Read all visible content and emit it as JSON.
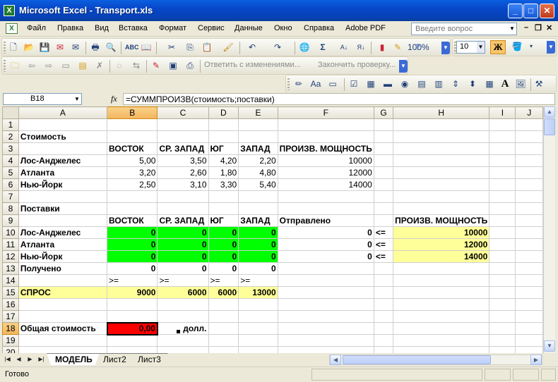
{
  "window": {
    "title": "Microsoft Excel - Transport.xls",
    "app_icon": "X"
  },
  "menu": {
    "items": [
      "Файл",
      "Правка",
      "Вид",
      "Вставка",
      "Формат",
      "Сервис",
      "Данные",
      "Окно",
      "Справка",
      "Adobe PDF"
    ],
    "ask_placeholder": "Введите вопрос"
  },
  "toolbar": {
    "font_size": "10",
    "bold_label": "Ж",
    "sum_symbol": "Σ",
    "reply_changes": "Ответить с изменениями...",
    "end_review": "Закончить проверку..."
  },
  "formula_bar": {
    "name_box": "B18",
    "fx": "fx",
    "formula": "=СУММПРОИЗВ(стоимость;поставки)"
  },
  "sheet": {
    "columns": [
      "A",
      "B",
      "C",
      "D",
      "E",
      "F",
      "G",
      "H",
      "I",
      "J"
    ],
    "rows": [
      "1",
      "2",
      "3",
      "4",
      "5",
      "6",
      "7",
      "8",
      "9",
      "10",
      "11",
      "12",
      "13",
      "14",
      "15",
      "16",
      "17",
      "18",
      "19",
      "20"
    ],
    "cells": {
      "A2": "Стоимость",
      "B3": "ВОСТОК",
      "C3": "СР. ЗАПАД",
      "D3": "ЮГ",
      "E3": "ЗАПАД",
      "F3": "ПРОИЗВ. МОЩНОСТЬ",
      "A4": "Лос-Анджелес",
      "B4": "5,00",
      "C4": "3,50",
      "D4": "4,20",
      "E4": "2,20",
      "F4": "10000",
      "A5": "Атланта",
      "B5": "3,20",
      "C5": "2,60",
      "D5": "1,80",
      "E5": "4,80",
      "F5": "12000",
      "A6": "Нью-Йорк",
      "B6": "2,50",
      "C6": "3,10",
      "D6": "3,30",
      "E6": "5,40",
      "F6": "14000",
      "A8": "Поставки",
      "B9": "ВОСТОК",
      "C9": "СР. ЗАПАД",
      "D9": "ЮГ",
      "E9": "ЗАПАД",
      "F9": "Отправлено",
      "H9": "ПРОИЗВ. МОЩНОСТЬ",
      "A10": "Лос-Анджелес",
      "B10": "0",
      "C10": "0",
      "D10": "0",
      "E10": "0",
      "F10": "0",
      "G10": "<=",
      "H10": "10000",
      "A11": "Атланта",
      "B11": "0",
      "C11": "0",
      "D11": "0",
      "E11": "0",
      "F11": "0",
      "G11": "<=",
      "H11": "12000",
      "A12": "Нью-Йорк",
      "B12": "0",
      "C12": "0",
      "D12": "0",
      "E12": "0",
      "F12": "0",
      "G12": "<=",
      "H12": "14000",
      "A13": "Получено",
      "B13": "0",
      "C13": "0",
      "D13": "0",
      "E13": "0",
      "B14": ">=",
      "C14": ">=",
      "D14": ">=",
      "E14": ">=",
      "A15": "СПРОС",
      "B15": "9000",
      "C15": "6000",
      "D15": "6000",
      "E15": "13000",
      "A18": "Общая стоимость",
      "B18": "0,00",
      "C18": "долл."
    }
  },
  "tabs": [
    "МОДЕЛЬ",
    "Лист2",
    "Лист3"
  ],
  "status": {
    "text": "Готово"
  },
  "colors": {
    "accent_selected_header": "#f3b45c",
    "green_fill": "#00ff00",
    "yellow_fill": "#ffff99",
    "red_fill": "#ff0000"
  }
}
